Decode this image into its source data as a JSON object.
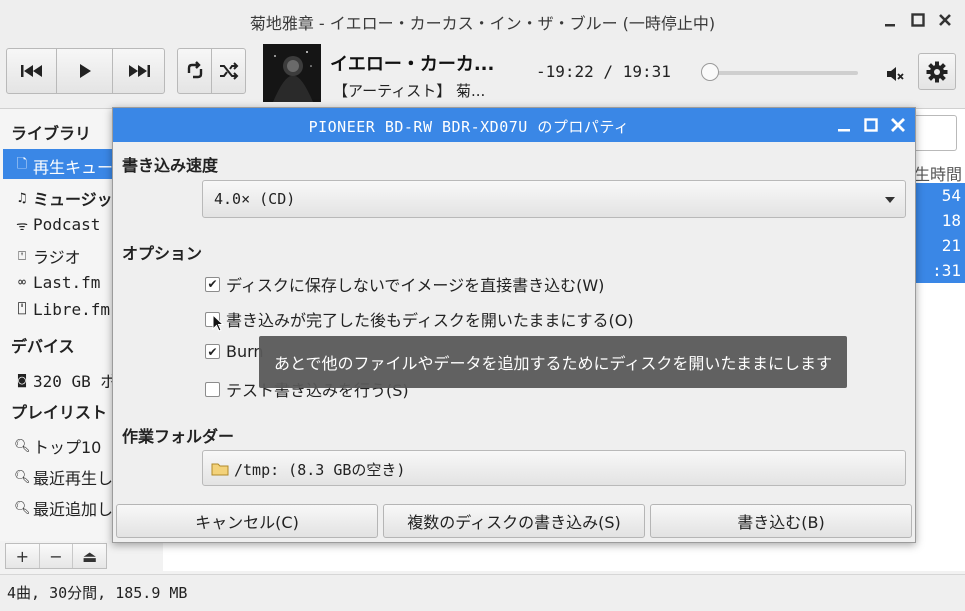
{
  "window": {
    "title": "菊地雅章 - イエロー・カーカス・イン・ザ・ブルー (一時停止中)"
  },
  "player": {
    "track_title": "イエロー・カーカ...",
    "track_artist": "【アーティスト】 菊...",
    "time_readout": "-19:22 / 19:31",
    "seek_position": 0.0
  },
  "sidebar": {
    "library_heading": "ライブラリ",
    "library_items": [
      {
        "label": "再生キュー",
        "icon": "document-icon"
      },
      {
        "label": "ミュージック",
        "icon": "music-note-icon"
      },
      {
        "label": "Podcast",
        "icon": "rss-icon"
      },
      {
        "label": "ラジオ",
        "icon": "radio-icon"
      },
      {
        "label": "Last.fm",
        "icon": "lastfm-icon"
      },
      {
        "label": "Libre.fm",
        "icon": "radio-icon"
      }
    ],
    "devices_heading": "デバイス",
    "device_items": [
      {
        "label": "320 GB ボ",
        "icon": "disk-icon"
      }
    ],
    "playlists_heading": "プレイリスト",
    "playlist_items": [
      {
        "label": "トップ10",
        "icon": "search-icon"
      },
      {
        "label": "最近再生し",
        "icon": "search-icon"
      },
      {
        "label": "最近追加し",
        "icon": "search-icon"
      }
    ]
  },
  "tracklist": {
    "column_header": "生時間",
    "durations": [
      "54",
      "18",
      "21",
      ":31"
    ]
  },
  "playlist_controls": [
    "+",
    "−",
    "⏏"
  ],
  "status_bar": "4曲, 30分間, 185.9 MB",
  "dialog": {
    "title": "PIONEER BD-RW  BDR-XD07U のプロパティ",
    "speed_heading": "書き込み速度",
    "speed_value": "4.0× (CD)",
    "options_heading": "オプション",
    "options": [
      {
        "label": "ディスクに保存しないでイメージを直接書き込む(W)",
        "checked": true
      },
      {
        "label": "書き込みが完了した後もディスクを開いたままにする(O)",
        "checked": false
      },
      {
        "label": "Burn",
        "checked": true
      },
      {
        "label": "テスト書き込みを行う(S)",
        "checked": false
      }
    ],
    "folder_heading": "作業フォルダー",
    "folder_value": "/tmp: (8.3 GBの空き)",
    "buttons": {
      "cancel": "キャンセル(C)",
      "multi": "複数のディスクの書き込み(S)",
      "burn": "書き込む(B)"
    }
  },
  "tooltip": "あとで他のファイルやデータを追加するためにディスクを開いたままにします"
}
